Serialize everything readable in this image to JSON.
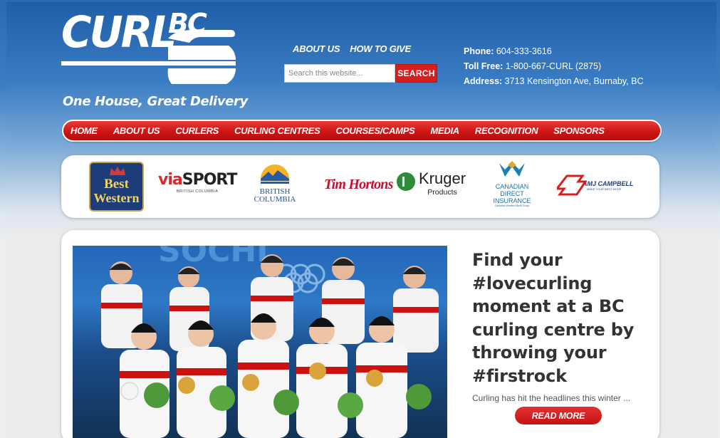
{
  "logo": {
    "word1": "CURL",
    "word2": "BC",
    "tagline": "One House, Great Delivery"
  },
  "top_links": [
    {
      "label": "ABOUT US"
    },
    {
      "label": "HOW TO GIVE"
    }
  ],
  "search": {
    "placeholder": "Search this website...",
    "button_label": "SEARCH"
  },
  "contact": {
    "phone_label": "Phone:",
    "phone": "604-333-3616",
    "tollfree_label": "Toll Free:",
    "tollfree": "1-800-667-CURL (2875)",
    "address_label": "Address:",
    "address": "3713 Kensington Ave, Burnaby, BC"
  },
  "nav": [
    {
      "label": "HOME"
    },
    {
      "label": "ABOUT US"
    },
    {
      "label": "CURLERS"
    },
    {
      "label": "CURLING CENTRES"
    },
    {
      "label": "COURSES/CAMPS"
    },
    {
      "label": "MEDIA"
    },
    {
      "label": "RECOGNITION"
    },
    {
      "label": "SPONSORS"
    }
  ],
  "sponsors": {
    "best_western": {
      "line1": "Best",
      "line2": "Western"
    },
    "viasport": {
      "via": "via",
      "sport": "SPORT",
      "sub": "BRITISH COLUMBIA"
    },
    "british_columbia": {
      "line1": "BRITISH",
      "line2": "COLUMBIA"
    },
    "tim_hortons": {
      "name": "Tim Hortons"
    },
    "kruger": {
      "name": "Kruger",
      "sub": "Products"
    },
    "cdi": {
      "line1": "CANADIAN",
      "line2": "DIRECT",
      "line3": "INSURANCE",
      "line4": "Canadian Western Bank Group"
    },
    "amj": {
      "name": "AMJ CAMPBELL",
      "sub": "MAKE YOUR BEST MOVE"
    }
  },
  "feature": {
    "headline": "Find your #lovecurling moment at a BC curling centre by throwing your #firstrock",
    "excerpt": "Curling has hit the headlines this winter ...",
    "read_more": "READ MORE",
    "photo_banner": "SOCHI"
  },
  "colors": {
    "brand_red": "#d81d1d",
    "brand_blue": "#2a6ab4"
  }
}
